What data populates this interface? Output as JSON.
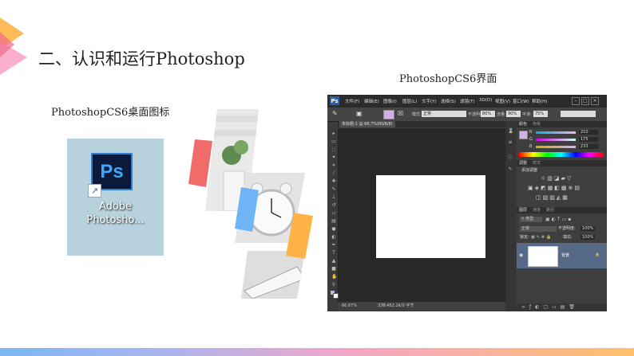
{
  "slide": {
    "title": "二、认识和运行Photoshop",
    "desktop_caption": "PhotoshopCS6桌面图标",
    "interface_caption": "PhotoshopCS6界面"
  },
  "desktop_icon": {
    "icon_text": "Ps",
    "shortcut_arrow": "↗",
    "label_line1": "Adobe",
    "label_line2": "Photosho..."
  },
  "photoshop": {
    "logo": "Ps",
    "menu": [
      "文件(F)",
      "编辑(E)",
      "图像(I)",
      "图层(L)",
      "文字(Y)",
      "选择(S)",
      "滤镜(T)",
      "3D(D)",
      "视图(V)",
      "窗口(W)",
      "帮助(H)"
    ],
    "window_buttons": [
      "–",
      "□",
      "×"
    ],
    "options": {
      "mode_label": "模式:",
      "mode_value": "正常",
      "opacity_label": "不透明度:",
      "opacity_value": "80%",
      "flow_label": "流量:",
      "flow_value": "90%",
      "smooth_label": "平滑:",
      "smooth_value": "75%"
    },
    "doc_tab": "未标题-1 @ 66.7%(RGB/8)",
    "status_zoom": "66.67%",
    "status_doc": "文档:452.2K/0 字节",
    "color_panel": {
      "tabs": [
        "颜色",
        "色板"
      ],
      "r_label": "R",
      "g_label": "G",
      "b_label": "B",
      "r": "210",
      "g": "175",
      "b": "233",
      "fg_color": "#d2afe9"
    },
    "adjust_panel": {
      "tabs": [
        "调整",
        "样式"
      ],
      "title": "添加调整"
    },
    "layers_panel": {
      "tabs": [
        "图层",
        "通道",
        "路径"
      ],
      "kind_label": "类型",
      "blend_mode": "正常",
      "opacity_label": "不透明度:",
      "opacity_value": "100%",
      "lock_label": "锁定:",
      "fill_label": "填充:",
      "fill_value": "100%",
      "layer_name": "背景"
    }
  },
  "colors": {
    "accent_orange": "#ffb347",
    "accent_pink": "#f26b8a",
    "accent_blue": "#7ab8f5",
    "ps_background": "#3c3c3c"
  }
}
